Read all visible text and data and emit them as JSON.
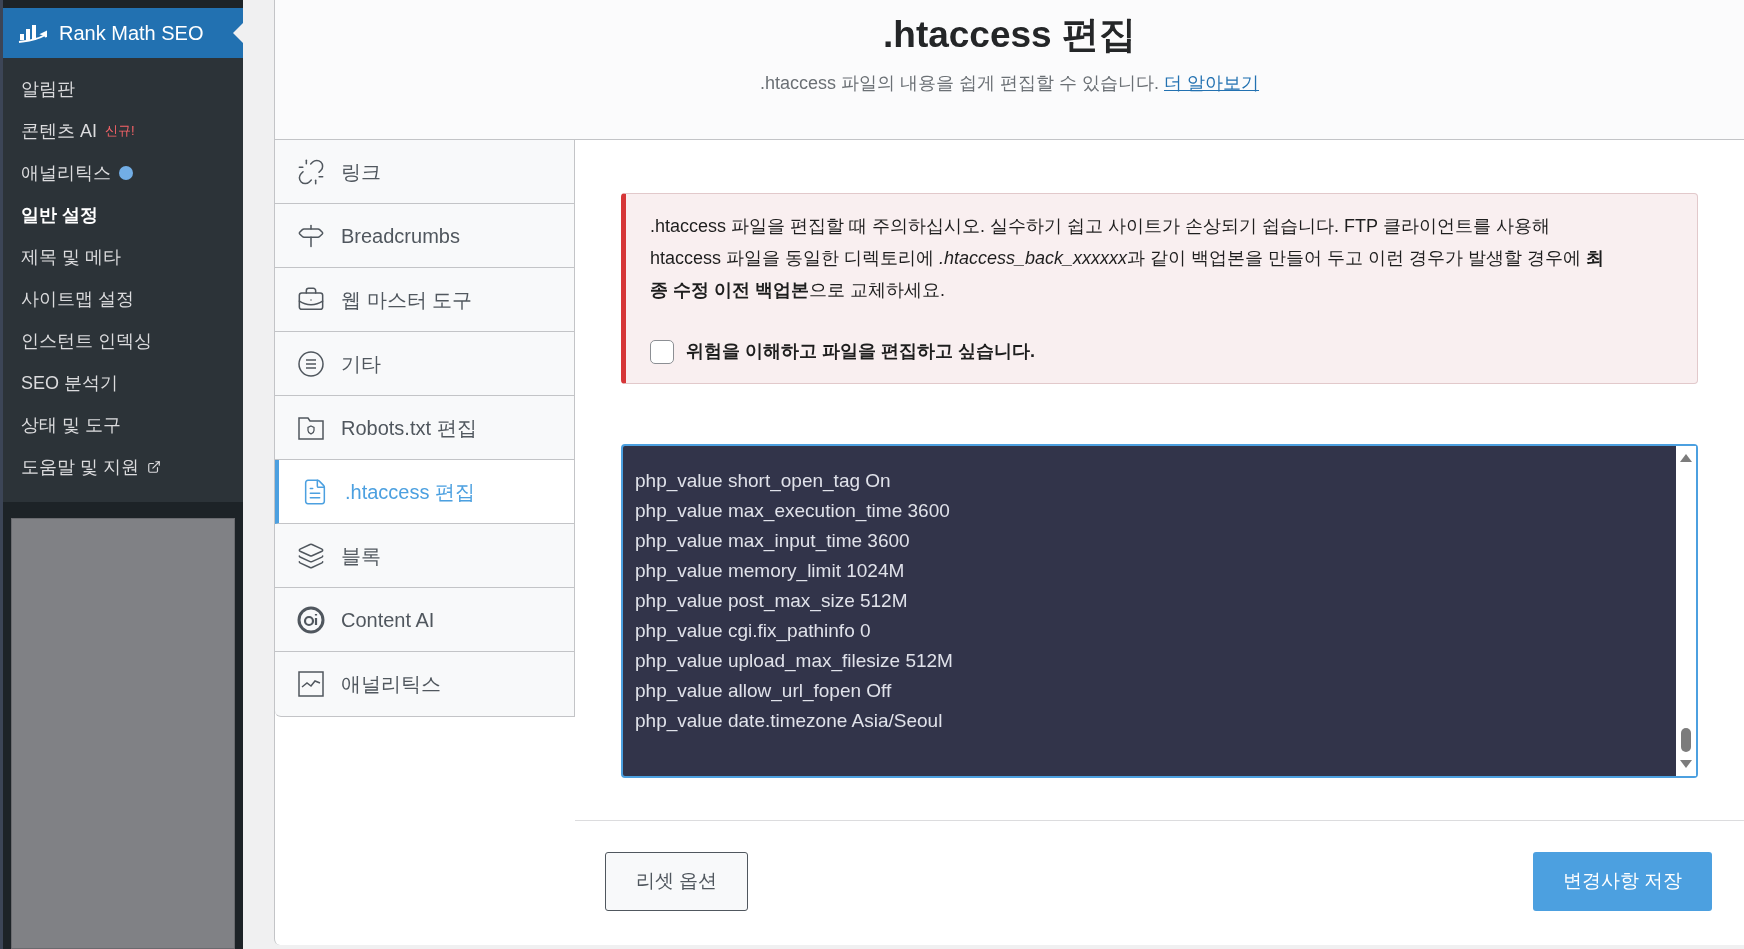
{
  "admin_menu": {
    "title": "Rank Math SEO",
    "items": [
      {
        "label": "알림판",
        "selected": false
      },
      {
        "label": "콘텐츠 AI",
        "badge": "신규!",
        "selected": false
      },
      {
        "label": "애널리틱스",
        "color": "#72aee6",
        "selected": false
      },
      {
        "label": "일반 설정",
        "selected": true
      },
      {
        "label": "제목 및 메타",
        "selected": false
      },
      {
        "label": "사이트맵 설정",
        "selected": false
      },
      {
        "label": "인스턴트 인덱싱",
        "selected": false
      },
      {
        "label": "SEO 분석기",
        "selected": false
      },
      {
        "label": "상태 및 도구",
        "selected": false
      },
      {
        "label": "도움말 및 지원",
        "external": true,
        "selected": false
      }
    ]
  },
  "header": {
    "title": ".htaccess 편집",
    "subtitle": ".htaccess 파일의 내용을 쉽게 편집할 수 있습니다.",
    "link": "더 알아보기"
  },
  "tabs": [
    {
      "kind": "link",
      "label": "링크",
      "selected": false
    },
    {
      "kind": "signpost",
      "label": "Breadcrumbs",
      "selected": false
    },
    {
      "kind": "toolbox",
      "label": "웹 마스터 도구",
      "selected": false
    },
    {
      "kind": "list",
      "label": "기타",
      "selected": false
    },
    {
      "kind": "folder",
      "label": "Robots.txt 편집",
      "selected": false
    },
    {
      "kind": "file",
      "label": ".htaccess 편집",
      "selected": true
    },
    {
      "kind": "layers",
      "label": "블록",
      "selected": false
    },
    {
      "kind": "ai",
      "label": "Content AI",
      "selected": false
    },
    {
      "kind": "chart",
      "label": "애널리틱스",
      "selected": false
    }
  ],
  "warning": {
    "text_before": ".htaccess 파일을 편집할 때 주의하십시오. 실수하기 쉽고 사이트가 손상되기 쉽습니다. FTP 클라이언트를 사용해 htaccess 파일을 동일한 디렉토리에 ",
    "italic_text": ".htaccess_back_xxxxxx",
    "text_after": "과 같이 백업본을 만들어 두고 이런 경우가 발생할 경우에 **최종 수정 이전 백업본**으로 교체하세요.",
    "checkbox_label": "위험을 이해하고 파일을 편집하고 싶습니다.",
    "checked": false
  },
  "editor_lines": [
    "php_value short_open_tag On",
    "php_value max_execution_time 3600",
    "php_value max_input_time 3600",
    "php_value memory_limit 1024M",
    "php_value post_max_size 512M",
    "php_value cgi.fix_pathinfo 0",
    "php_value upload_max_filesize 512M",
    "php_value allow_url_fopen Off",
    "php_value date.timezone Asia/Seoul"
  ],
  "footer": {
    "reset": "리셋 옵션",
    "save": "변경사항 저장"
  }
}
